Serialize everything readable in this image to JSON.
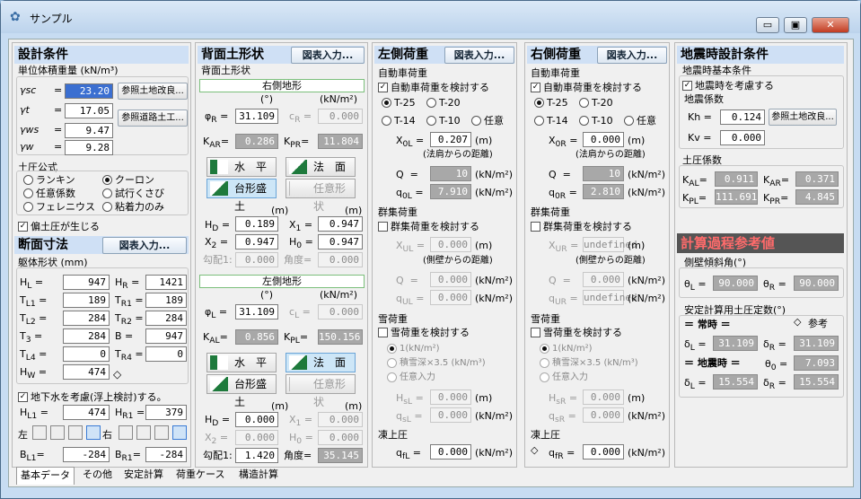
{
  "window": {
    "title": "サンプル"
  },
  "p1": {
    "header": "設計条件",
    "unit_title": "単位体積重量 (kN/m³)",
    "rows": [
      {
        "sym": "γsc",
        "val": "23.20",
        "btn": "参照土地改良..."
      },
      {
        "sym": "γt",
        "val": "17.05",
        "btn": "参照道路土工..."
      },
      {
        "sym": "γws",
        "val": "9.47"
      },
      {
        "sym": "γw",
        "val": "9.28"
      }
    ],
    "earth_title": "土圧公式",
    "radios": [
      "ランキン",
      "クーロン",
      "任意係数",
      "試行くさび",
      "フェレニウス",
      "粘着力のみ"
    ],
    "eccentric": "偏土圧が生じる",
    "header2": "断面寸法",
    "btn2": "図表入力...",
    "body_title": "躯体形状 (mm)",
    "dims": [
      [
        "HL",
        "947",
        "HR",
        "1421"
      ],
      [
        "TL1",
        "189",
        "TR1",
        "189"
      ],
      [
        "TL2",
        "284",
        "TR2",
        "284"
      ],
      [
        "T3",
        "284",
        "B",
        "947"
      ],
      [
        "TL4",
        "0",
        "TR4",
        "0"
      ],
      [
        "HW",
        "474",
        "",
        ""
      ]
    ],
    "groundwater": "地下水を考慮(浮上検討)する。",
    "hl1": "474",
    "hr1": "379",
    "left": "左",
    "right": "右",
    "bl1": "-284",
    "br1": "-284"
  },
  "p2": {
    "header": "背面土形状",
    "btn": "図表入力...",
    "sub": "背面土形状",
    "right_title": "右側地形",
    "deg": "(°)",
    "unit": "(kN/m²)",
    "phiR": "31.109",
    "cR": "0.000",
    "KAR": "0.286",
    "KPR": "11.804",
    "flat": "水　平",
    "slope": "法　面",
    "bank": "台形盛土",
    "free": "任意形状",
    "m": "(m)",
    "HD": "0.189",
    "X1": "0.947",
    "X2": "0.947",
    "H0": "0.947",
    "grad": "勾配1:",
    "gradv": "0.000",
    "angle": "角度=",
    "anglev": "0.000",
    "left_title": "左側地形",
    "phiL": "31.109",
    "cL": "0.000",
    "KAL": "0.856",
    "KPL": "150.156",
    "HD2": "0.000",
    "X1b": "0.000",
    "X2b": "0.000",
    "H0b": "0.000",
    "gradv2": "1.420",
    "anglev2": "35.145"
  },
  "p3": {
    "header": "左側荷重",
    "btn": "図表入力...",
    "car": "自動車荷重",
    "car_chk": "自動車荷重を検討する",
    "r": [
      "T-25",
      "T-20",
      "T-14",
      "T-10",
      "任意"
    ],
    "x": "0.207",
    "dist": "(法肩からの距離)",
    "q": "10",
    "qv": "7.910",
    "group": "群集荷重",
    "group_chk": "群集荷重を検討する",
    "xul": "0.000",
    "dist2": "(側壁からの距離)",
    "q2": "0.000",
    "qul": "0.000",
    "snow": "雪荷重",
    "snow_chk": "雪荷重を検討する",
    "s1": "1(kN/m²)",
    "s2": "積雪深×3.5 (kN/m³)",
    "s3": "任意入力",
    "hsl": "0.000",
    "qsl": "0.000",
    "frost": "凍上圧",
    "qfl": "0.000"
  },
  "p4": {
    "header": "右側荷重",
    "btn": "図表入力...",
    "x": "0.000",
    "q": "10",
    "qv": "2.810",
    "xur": "0.000",
    "q2": "0.000",
    "qur": "0.000",
    "hsr": "0.000",
    "qsr": "0.000",
    "qfr": "0.000"
  },
  "p5": {
    "header": "地震時設計条件",
    "basic": "地震時基本条件",
    "eq_chk": "地震時を考慮する",
    "coef": "地震係数",
    "kh": "0.124",
    "kv": "0.000",
    "btn": "参照土地改良...",
    "ecoef": "土圧係数",
    "KAL": "0.911",
    "KAR": "0.371",
    "KPL": "111.691",
    "KPR": "4.845",
    "calc": "計算過程参考値",
    "wall": "側壁傾斜角(°)",
    "thL": "90.000",
    "thR": "90.000",
    "safe": "安定計算用土圧定数(°)",
    "ref": "参考",
    "normal": "＝ 常時 ＝",
    "dL": "31.109",
    "dR": "31.109",
    "quake": "＝ 地震時 ＝",
    "th0": "7.093",
    "dL2": "15.554",
    "dR2": "15.554"
  },
  "tabs": [
    "基本データ",
    "その他",
    "安定計算",
    "荷重ケース",
    "構造計算"
  ]
}
